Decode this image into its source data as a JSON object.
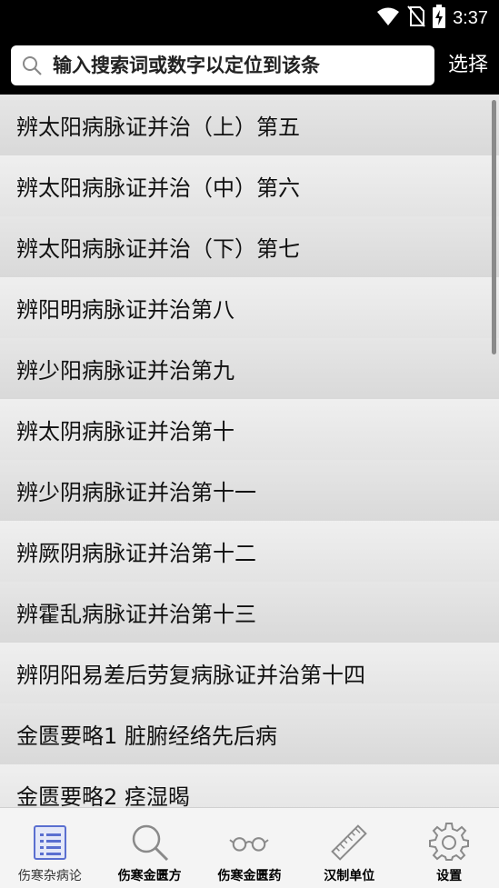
{
  "status_bar": {
    "time": "3:37",
    "icons": [
      "wifi-icon",
      "no-sim-icon",
      "battery-charging-icon"
    ]
  },
  "search": {
    "placeholder": "输入搜索词或数字以定位到该条",
    "select_label": "选择"
  },
  "list": {
    "items": [
      "辨太阳病脉证并治（上）第五",
      "辨太阳病脉证并治（中）第六",
      "辨太阳病脉证并治（下）第七",
      "辨阳明病脉证并治第八",
      "辨少阳病脉证并治第九",
      "辨太阴病脉证并治第十",
      "辨少阴病脉证并治第十一",
      "辨厥阴病脉证并治第十二",
      "辨霍乱病脉证并治第十三",
      "辨阴阳易差后劳复病脉证并治第十四",
      "金匮要略1  脏腑经络先后病",
      "金匮要略2  痉湿暍"
    ]
  },
  "bottom_nav": {
    "items": [
      {
        "label": "伤寒杂病论",
        "icon": "list-document-icon",
        "active": true
      },
      {
        "label": "伤寒金匮方",
        "icon": "search-icon",
        "active": false
      },
      {
        "label": "伤寒金匮药",
        "icon": "glasses-icon",
        "active": false
      },
      {
        "label": "汉制单位",
        "icon": "ruler-icon",
        "active": false
      },
      {
        "label": "设置",
        "icon": "gear-icon",
        "active": false
      }
    ]
  },
  "colors": {
    "active_nav": "#5a6fd0",
    "inactive_nav": "#8a8a8a"
  }
}
